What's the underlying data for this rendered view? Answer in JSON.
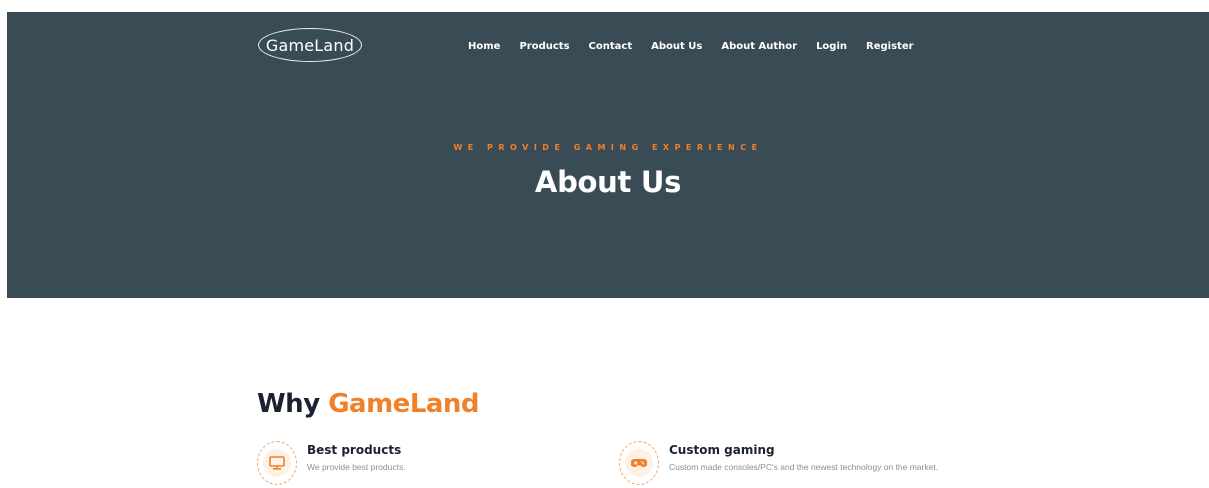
{
  "header": {
    "logo_text": "GameLand",
    "nav": [
      "Home",
      "Products",
      "Contact",
      "About Us",
      "About Author",
      "Login",
      "Register"
    ]
  },
  "hero": {
    "tagline": "WE PROVIDE GAMING EXPERIENCE",
    "title": "About Us"
  },
  "why": {
    "title_prefix": "Why",
    "title_accent": "GameLand",
    "features": [
      {
        "icon": "monitor-icon",
        "title": "Best products",
        "description": "We provide best products."
      },
      {
        "icon": "gamepad-icon",
        "title": "Custom gaming",
        "description": "Custom made consoles/PC's and the newest technology on the market."
      }
    ]
  },
  "colors": {
    "hero_bg": "#394b55",
    "accent": "#f0802a",
    "heading": "#1b2230",
    "muted": "#8a8f96"
  }
}
